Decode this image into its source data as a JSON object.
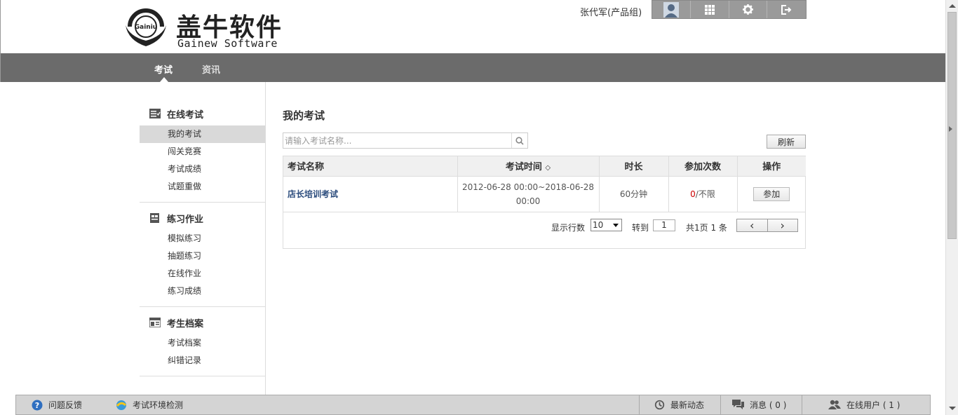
{
  "header": {
    "logo_cn": "盖牛软件",
    "logo_en": "Gainew Software",
    "logo_emblem_text": "Gainiu",
    "user_name": "张代军(产品组)",
    "toolbar": [
      "avatar-icon",
      "apps-grid-icon",
      "gear-icon",
      "logout-icon"
    ]
  },
  "nav": {
    "items": [
      {
        "label": "考试",
        "active": true
      },
      {
        "label": "资讯",
        "active": false
      }
    ]
  },
  "sidebar": {
    "groups": [
      {
        "title": "在线考试",
        "icon": "exam-list-icon",
        "items": [
          "我的考试",
          "闯关竞赛",
          "考试成绩",
          "试题重做"
        ]
      },
      {
        "title": "练习作业",
        "icon": "practice-icon",
        "items": [
          "模拟练习",
          "抽题练习",
          "在线作业",
          "练习成绩"
        ]
      },
      {
        "title": "考生档案",
        "icon": "archive-icon",
        "items": [
          "考试档案",
          "纠错记录"
        ]
      }
    ],
    "active_item": "我的考试"
  },
  "main": {
    "title": "我的考试",
    "search_placeholder": "请输入考试名称...",
    "refresh_label": "刷新",
    "table": {
      "headers": [
        "考试名称",
        "考试时间",
        "时长",
        "参加次数",
        "操作"
      ],
      "sort_indicator": "◇",
      "rows": [
        {
          "name": "店长培训考试",
          "time_line1": "2012-06-28 00:00~2018-06-28",
          "time_line2": "00:00",
          "duration": "60分钟",
          "attempts_used": "0",
          "attempts_limit": "/不限",
          "action": "参加"
        }
      ]
    },
    "pager": {
      "rows_label": "显示行数",
      "rows_value": "10",
      "goto_label": "转到",
      "goto_value": "1",
      "summary": "共1页 1 条",
      "prev": "‹",
      "next": "›"
    }
  },
  "footer": {
    "feedback": "问题反馈",
    "env_check": "考试环境检测",
    "news": "最新动态",
    "messages": "消息 ( 0 )",
    "online_users": "在线用户 ( 1 )"
  },
  "colors": {
    "nav_bg": "#6b6b6b",
    "link": "#2a4b7c",
    "attempts_red": "#cc0000",
    "footer_bg": "#d4d4d4"
  }
}
